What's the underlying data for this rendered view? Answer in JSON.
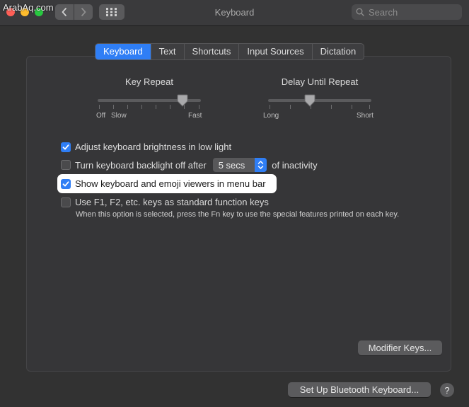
{
  "window": {
    "title": "Keyboard",
    "watermark": "ArabAq.com"
  },
  "toolbar": {
    "back_icon": "chevron-left-icon",
    "forward_icon": "chevron-right-icon",
    "grid_icon": "show-all-grid-icon"
  },
  "search": {
    "placeholder": "Search",
    "value": ""
  },
  "tabs": [
    {
      "label": "Keyboard",
      "active": true
    },
    {
      "label": "Text",
      "active": false
    },
    {
      "label": "Shortcuts",
      "active": false
    },
    {
      "label": "Input Sources",
      "active": false
    },
    {
      "label": "Dictation",
      "active": false
    }
  ],
  "key_repeat": {
    "title": "Key Repeat",
    "labels": {
      "off": "Off",
      "slow": "Slow",
      "fast": "Fast"
    },
    "level": 0.83
  },
  "delay_until_repeat": {
    "title": "Delay Until Repeat",
    "labels": {
      "long": "Long",
      "short": "Short"
    },
    "level": 0.4
  },
  "options": {
    "brightness": {
      "label": "Adjust keyboard brightness in low light",
      "checked": true
    },
    "backlight": {
      "label_before": "Turn keyboard backlight off after",
      "popup_value": "5 secs",
      "label_after": "of inactivity",
      "checked": false
    },
    "viewers": {
      "label": "Show keyboard and emoji viewers in menu bar",
      "checked": true
    },
    "function_keys": {
      "label": "Use F1, F2, etc. keys as standard function keys",
      "note": "When this option is selected, press the Fn key to use the special features printed on each key.",
      "checked": false
    }
  },
  "buttons": {
    "modifier_keys": "Modifier Keys...",
    "bluetooth": "Set Up Bluetooth Keyboard...",
    "help": "?"
  },
  "colors": {
    "accent": "#2f7ef5",
    "highlight": "#ffffff"
  }
}
